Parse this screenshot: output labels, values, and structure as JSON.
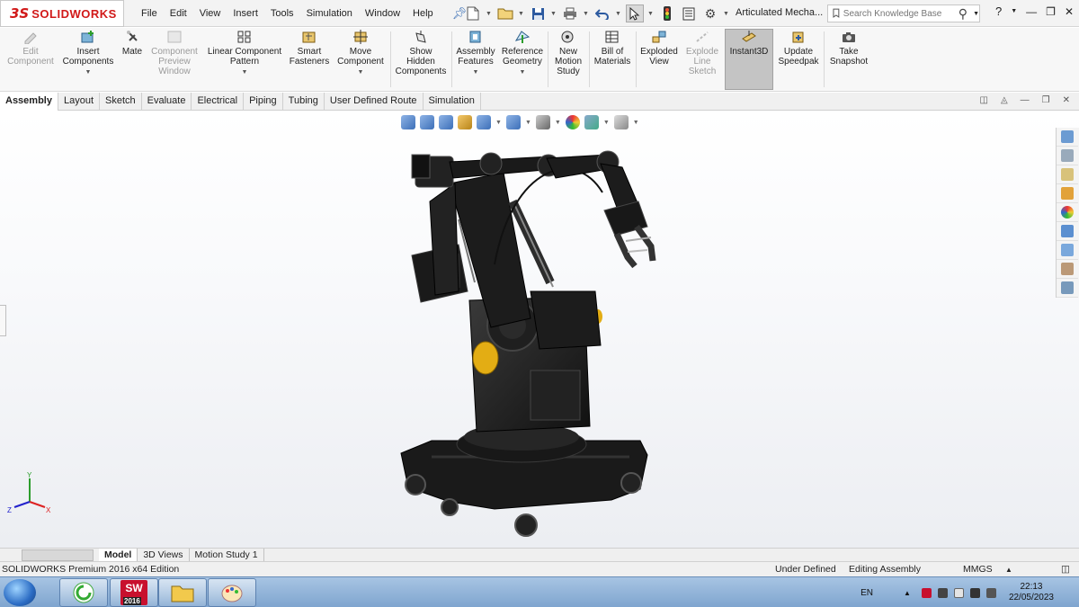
{
  "app": {
    "logo_ds": "3S",
    "logo_name": "SOLIDWORKS",
    "document_title": "Articulated Mecha...",
    "menu": [
      "File",
      "Edit",
      "View",
      "Insert",
      "Tools",
      "Simulation",
      "Window",
      "Help"
    ]
  },
  "search": {
    "placeholder": "Search Knowledge Base"
  },
  "commands": [
    {
      "label": "Edit\nComponent",
      "enabled": false,
      "icon": "edit-component-icon"
    },
    {
      "label": "Insert\nComponents",
      "enabled": true,
      "icon": "insert-components-icon",
      "dropdown": true
    },
    {
      "label": "Mate",
      "enabled": true,
      "icon": "mate-icon"
    },
    {
      "label": "Component\nPreview\nWindow",
      "enabled": false,
      "icon": "component-preview-icon"
    },
    {
      "label": "Linear Component\nPattern",
      "enabled": true,
      "icon": "linear-pattern-icon",
      "dropdown": true
    },
    {
      "label": "Smart\nFasteners",
      "enabled": true,
      "icon": "smart-fasteners-icon"
    },
    {
      "label": "Move\nComponent",
      "enabled": true,
      "icon": "move-component-icon",
      "dropdown": true
    },
    {
      "label": "Show\nHidden\nComponents",
      "enabled": true,
      "icon": "show-hidden-icon"
    },
    {
      "label": "Assembly\nFeatures",
      "enabled": true,
      "icon": "assembly-features-icon",
      "dropdown": true
    },
    {
      "label": "Reference\nGeometry",
      "enabled": true,
      "icon": "reference-geometry-icon",
      "dropdown": true
    },
    {
      "label": "New\nMotion\nStudy",
      "enabled": true,
      "icon": "motion-study-icon"
    },
    {
      "label": "Bill of\nMaterials",
      "enabled": true,
      "icon": "bom-icon"
    },
    {
      "label": "Exploded\nView",
      "enabled": true,
      "icon": "exploded-view-icon"
    },
    {
      "label": "Explode\nLine\nSketch",
      "enabled": false,
      "icon": "explode-line-icon"
    },
    {
      "label": "Instant3D",
      "enabled": true,
      "icon": "instant3d-icon",
      "active": true
    },
    {
      "label": "Update\nSpeedpak",
      "enabled": true,
      "icon": "speedpak-icon"
    },
    {
      "label": "Take\nSnapshot",
      "enabled": true,
      "icon": "snapshot-icon"
    }
  ],
  "tabs": [
    "Assembly",
    "Layout",
    "Sketch",
    "Evaluate",
    "Electrical",
    "Piping",
    "Tubing",
    "User Defined Route",
    "Simulation"
  ],
  "active_tab": "Assembly",
  "bottom_tabs": [
    "Model",
    "3D Views",
    "Motion Study 1"
  ],
  "active_bottom_tab": "Model",
  "triad": {
    "x": "X",
    "y": "Y",
    "z": "Z"
  },
  "status": {
    "edition": "SOLIDWORKS Premium 2016 x64 Edition",
    "definition": "Under Defined",
    "mode": "Editing Assembly",
    "units": "MMGS"
  },
  "taskbar": {
    "lang": "EN",
    "time": "22:13",
    "date": "22/05/2023",
    "sw_badge": "2016"
  },
  "colors": {
    "brand": "#d11919",
    "robot": "#1c1c1c",
    "accent_yellow": "#e7b416"
  }
}
